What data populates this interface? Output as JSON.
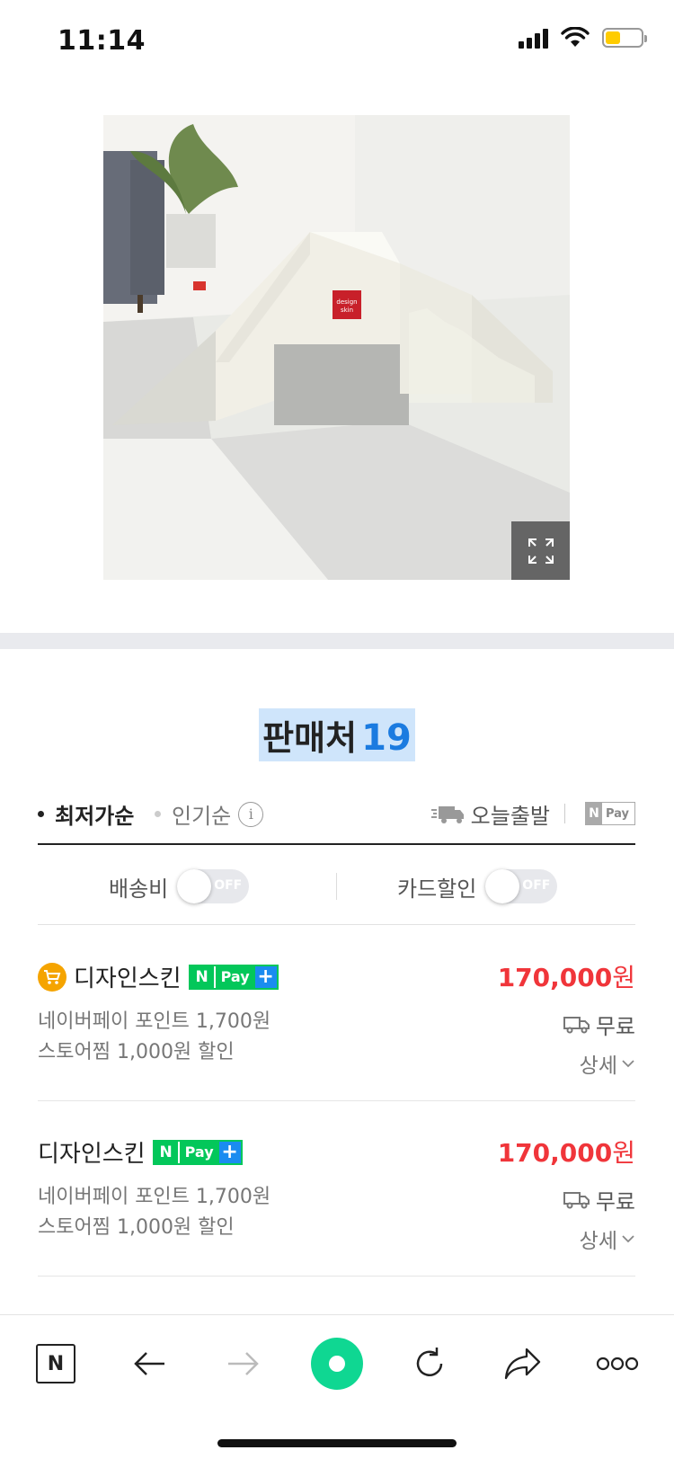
{
  "status_bar": {
    "time": "11:14"
  },
  "product_image": {
    "brand_tag_lines": [
      "design",
      "skin"
    ],
    "alt": "product photo"
  },
  "sellers": {
    "title": "판매처",
    "count": "19"
  },
  "sort": {
    "lowest_price": "최저가순",
    "popular": "인기순",
    "info_glyph": "i",
    "today_ship": "오늘출발",
    "npay_n": "N",
    "npay_label": "Pay"
  },
  "filters": {
    "shipping_fee": {
      "label": "배송비",
      "state": "OFF"
    },
    "card_discount": {
      "label": "카드할인",
      "state": "OFF"
    }
  },
  "listings": [
    {
      "has_cart_badge": true,
      "seller": "디자인스킨",
      "npay": {
        "n": "N",
        "pay": "Pay",
        "plus": "+"
      },
      "price": "170,000",
      "price_unit": "원",
      "point": "네이버페이 포인트 1,700원",
      "discount": "스토어찜 1,000원 할인",
      "shipping": "무료",
      "detail": "상세"
    },
    {
      "has_cart_badge": false,
      "seller": "디자인스킨",
      "npay": {
        "n": "N",
        "pay": "Pay",
        "plus": "+"
      },
      "price": "170,000",
      "price_unit": "원",
      "point": "네이버페이 포인트 1,700원",
      "discount": "스토어찜 1,000원 할인",
      "shipping": "무료",
      "detail": "상세"
    }
  ],
  "toolbar": {
    "naver_logo": "N",
    "icons": [
      "naver-home-icon",
      "back-arrow-icon",
      "forward-arrow-icon",
      "green-dot-icon",
      "refresh-icon",
      "share-icon",
      "more-icon"
    ]
  },
  "colors": {
    "price_red": "#f0353a",
    "count_blue": "#1b7be0",
    "npay_green": "#03c75a",
    "plus_blue": "#1a8cf0",
    "cart_orange": "#f5a400",
    "toolbar_green": "#0fd792"
  }
}
